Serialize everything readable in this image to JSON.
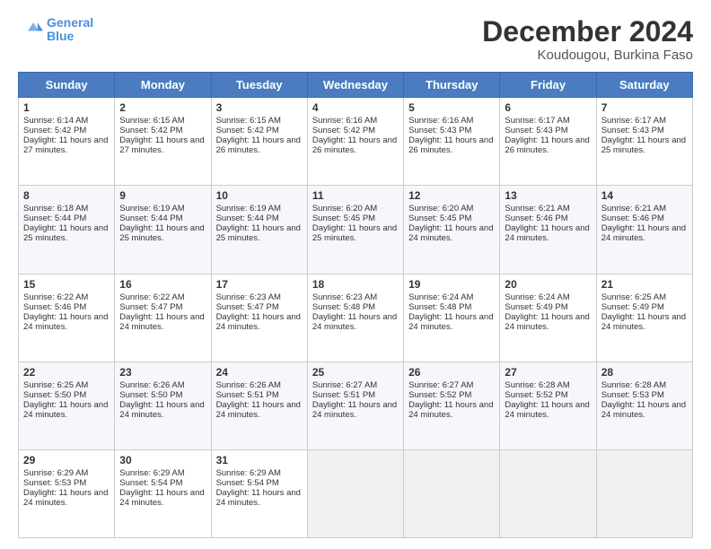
{
  "header": {
    "logo_line1": "General",
    "logo_line2": "Blue",
    "month": "December 2024",
    "location": "Koudougou, Burkina Faso"
  },
  "days_of_week": [
    "Sunday",
    "Monday",
    "Tuesday",
    "Wednesday",
    "Thursday",
    "Friday",
    "Saturday"
  ],
  "weeks": [
    [
      {
        "day": 1,
        "sunrise": "6:14 AM",
        "sunset": "5:42 PM",
        "daylight": "11 hours and 27 minutes."
      },
      {
        "day": 2,
        "sunrise": "6:15 AM",
        "sunset": "5:42 PM",
        "daylight": "11 hours and 27 minutes."
      },
      {
        "day": 3,
        "sunrise": "6:15 AM",
        "sunset": "5:42 PM",
        "daylight": "11 hours and 26 minutes."
      },
      {
        "day": 4,
        "sunrise": "6:16 AM",
        "sunset": "5:42 PM",
        "daylight": "11 hours and 26 minutes."
      },
      {
        "day": 5,
        "sunrise": "6:16 AM",
        "sunset": "5:43 PM",
        "daylight": "11 hours and 26 minutes."
      },
      {
        "day": 6,
        "sunrise": "6:17 AM",
        "sunset": "5:43 PM",
        "daylight": "11 hours and 26 minutes."
      },
      {
        "day": 7,
        "sunrise": "6:17 AM",
        "sunset": "5:43 PM",
        "daylight": "11 hours and 25 minutes."
      }
    ],
    [
      {
        "day": 8,
        "sunrise": "6:18 AM",
        "sunset": "5:44 PM",
        "daylight": "11 hours and 25 minutes."
      },
      {
        "day": 9,
        "sunrise": "6:19 AM",
        "sunset": "5:44 PM",
        "daylight": "11 hours and 25 minutes."
      },
      {
        "day": 10,
        "sunrise": "6:19 AM",
        "sunset": "5:44 PM",
        "daylight": "11 hours and 25 minutes."
      },
      {
        "day": 11,
        "sunrise": "6:20 AM",
        "sunset": "5:45 PM",
        "daylight": "11 hours and 25 minutes."
      },
      {
        "day": 12,
        "sunrise": "6:20 AM",
        "sunset": "5:45 PM",
        "daylight": "11 hours and 24 minutes."
      },
      {
        "day": 13,
        "sunrise": "6:21 AM",
        "sunset": "5:46 PM",
        "daylight": "11 hours and 24 minutes."
      },
      {
        "day": 14,
        "sunrise": "6:21 AM",
        "sunset": "5:46 PM",
        "daylight": "11 hours and 24 minutes."
      }
    ],
    [
      {
        "day": 15,
        "sunrise": "6:22 AM",
        "sunset": "5:46 PM",
        "daylight": "11 hours and 24 minutes."
      },
      {
        "day": 16,
        "sunrise": "6:22 AM",
        "sunset": "5:47 PM",
        "daylight": "11 hours and 24 minutes."
      },
      {
        "day": 17,
        "sunrise": "6:23 AM",
        "sunset": "5:47 PM",
        "daylight": "11 hours and 24 minutes."
      },
      {
        "day": 18,
        "sunrise": "6:23 AM",
        "sunset": "5:48 PM",
        "daylight": "11 hours and 24 minutes."
      },
      {
        "day": 19,
        "sunrise": "6:24 AM",
        "sunset": "5:48 PM",
        "daylight": "11 hours and 24 minutes."
      },
      {
        "day": 20,
        "sunrise": "6:24 AM",
        "sunset": "5:49 PM",
        "daylight": "11 hours and 24 minutes."
      },
      {
        "day": 21,
        "sunrise": "6:25 AM",
        "sunset": "5:49 PM",
        "daylight": "11 hours and 24 minutes."
      }
    ],
    [
      {
        "day": 22,
        "sunrise": "6:25 AM",
        "sunset": "5:50 PM",
        "daylight": "11 hours and 24 minutes."
      },
      {
        "day": 23,
        "sunrise": "6:26 AM",
        "sunset": "5:50 PM",
        "daylight": "11 hours and 24 minutes."
      },
      {
        "day": 24,
        "sunrise": "6:26 AM",
        "sunset": "5:51 PM",
        "daylight": "11 hours and 24 minutes."
      },
      {
        "day": 25,
        "sunrise": "6:27 AM",
        "sunset": "5:51 PM",
        "daylight": "11 hours and 24 minutes."
      },
      {
        "day": 26,
        "sunrise": "6:27 AM",
        "sunset": "5:52 PM",
        "daylight": "11 hours and 24 minutes."
      },
      {
        "day": 27,
        "sunrise": "6:28 AM",
        "sunset": "5:52 PM",
        "daylight": "11 hours and 24 minutes."
      },
      {
        "day": 28,
        "sunrise": "6:28 AM",
        "sunset": "5:53 PM",
        "daylight": "11 hours and 24 minutes."
      }
    ],
    [
      {
        "day": 29,
        "sunrise": "6:29 AM",
        "sunset": "5:53 PM",
        "daylight": "11 hours and 24 minutes."
      },
      {
        "day": 30,
        "sunrise": "6:29 AM",
        "sunset": "5:54 PM",
        "daylight": "11 hours and 24 minutes."
      },
      {
        "day": 31,
        "sunrise": "6:29 AM",
        "sunset": "5:54 PM",
        "daylight": "11 hours and 24 minutes."
      },
      null,
      null,
      null,
      null
    ]
  ]
}
